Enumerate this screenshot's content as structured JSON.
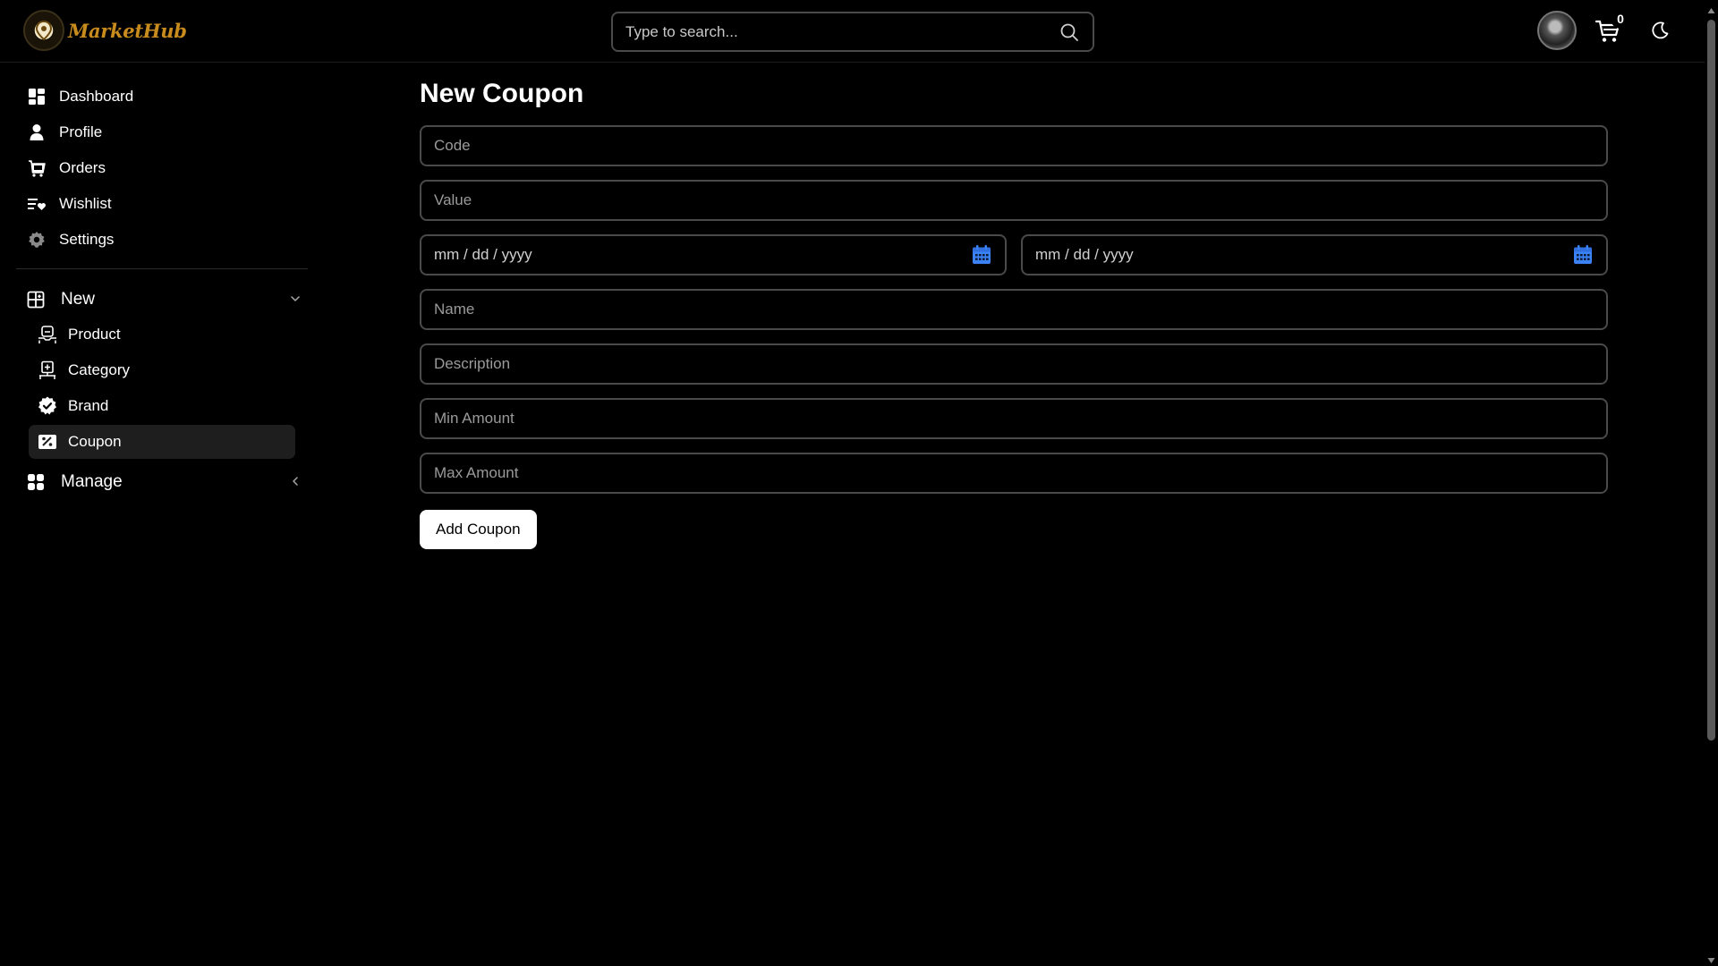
{
  "brand": {
    "name": "MarketHub"
  },
  "search": {
    "placeholder": "Type to search..."
  },
  "header": {
    "cart_count": "0"
  },
  "sidebar": {
    "items": [
      {
        "label": "Dashboard",
        "icon": "dashboard-icon"
      },
      {
        "label": "Profile",
        "icon": "user-icon"
      },
      {
        "label": "Orders",
        "icon": "cart-icon"
      },
      {
        "label": "Wishlist",
        "icon": "wishlist-icon"
      },
      {
        "label": "Settings",
        "icon": "gear-icon"
      }
    ],
    "groups": [
      {
        "label": "New",
        "expanded": true,
        "items": [
          {
            "label": "Product",
            "icon": "product-icon"
          },
          {
            "label": "Category",
            "icon": "category-icon"
          },
          {
            "label": "Brand",
            "icon": "brand-badge-icon"
          },
          {
            "label": "Coupon",
            "icon": "coupon-icon",
            "active": true
          }
        ]
      },
      {
        "label": "Manage",
        "expanded": false,
        "items": []
      }
    ]
  },
  "form": {
    "title": "New Coupon",
    "code_placeholder": "Code",
    "value_placeholder": "Value",
    "start_date_placeholder": "mm / dd / yyyy",
    "end_date_placeholder": "mm / dd / yyyy",
    "name_placeholder": "Name",
    "description_placeholder": "Description",
    "min_amount_placeholder": "Min Amount",
    "max_amount_placeholder": "Max Amount",
    "submit_label": "Add Coupon"
  },
  "colors": {
    "background": "#000000",
    "brand": "#c88b1d",
    "accent_calendar": "#3b82f6",
    "field_border": "#4a4a4a",
    "active_item_bg": "#1e1e1e"
  }
}
